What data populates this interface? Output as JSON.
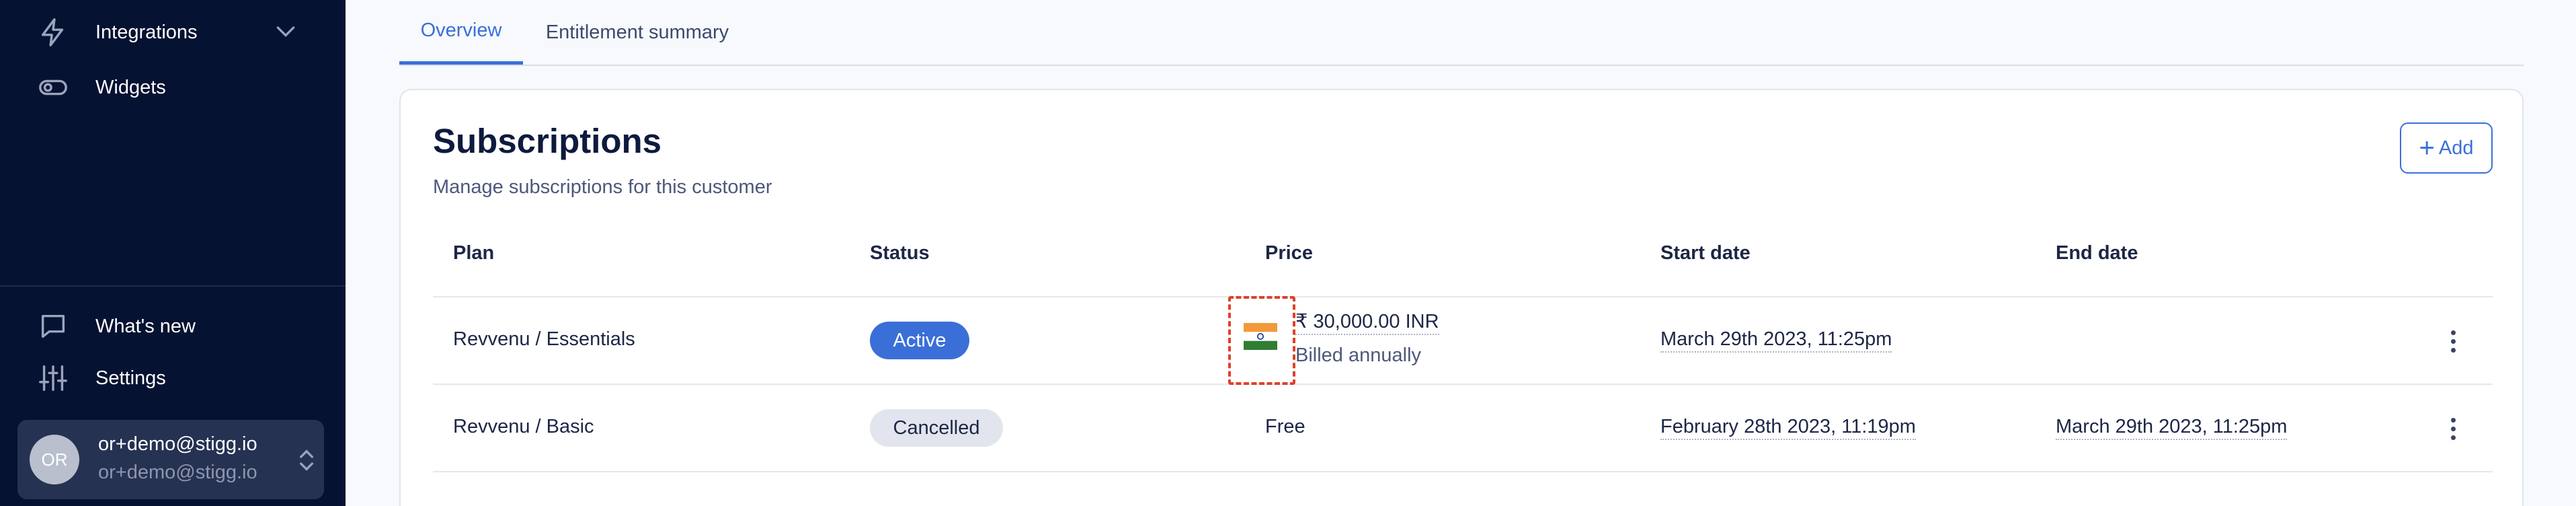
{
  "sidebar": {
    "items": [
      {
        "label": "Integrations",
        "icon": "lightning-icon"
      },
      {
        "label": "Widgets",
        "icon": "toggle-icon"
      }
    ],
    "bottom_items": [
      {
        "label": "What's new",
        "icon": "chat-bubble-icon"
      },
      {
        "label": "Settings",
        "icon": "sliders-icon"
      }
    ],
    "user": {
      "initials": "OR",
      "name": "or+demo@stigg.io",
      "email": "or+demo@stigg.io"
    }
  },
  "tabs": [
    {
      "label": "Overview",
      "active": true
    },
    {
      "label": "Entitlement summary",
      "active": false
    }
  ],
  "subscriptions": {
    "title": "Subscriptions",
    "subtitle": "Manage subscriptions for this customer",
    "add_label": "Add",
    "columns": [
      "Plan",
      "Status",
      "Price",
      "Start date",
      "End date"
    ],
    "rows": [
      {
        "plan": "Revvenu / Essentials",
        "status": "Active",
        "price": "₹ 30,000.00 INR",
        "billing": "Billed annually",
        "start_date": "March 29th 2023, 11:25pm",
        "end_date": ""
      },
      {
        "plan": "Revvenu / Basic",
        "status": "Cancelled",
        "price": "Free",
        "billing": "",
        "start_date": "February 28th 2023, 11:19pm",
        "end_date": "March 29th 2023, 11:25pm"
      }
    ]
  },
  "colors": {
    "sidebar_bg": "#061231",
    "accent": "#3a6fd8",
    "highlight": "#e0402a"
  }
}
